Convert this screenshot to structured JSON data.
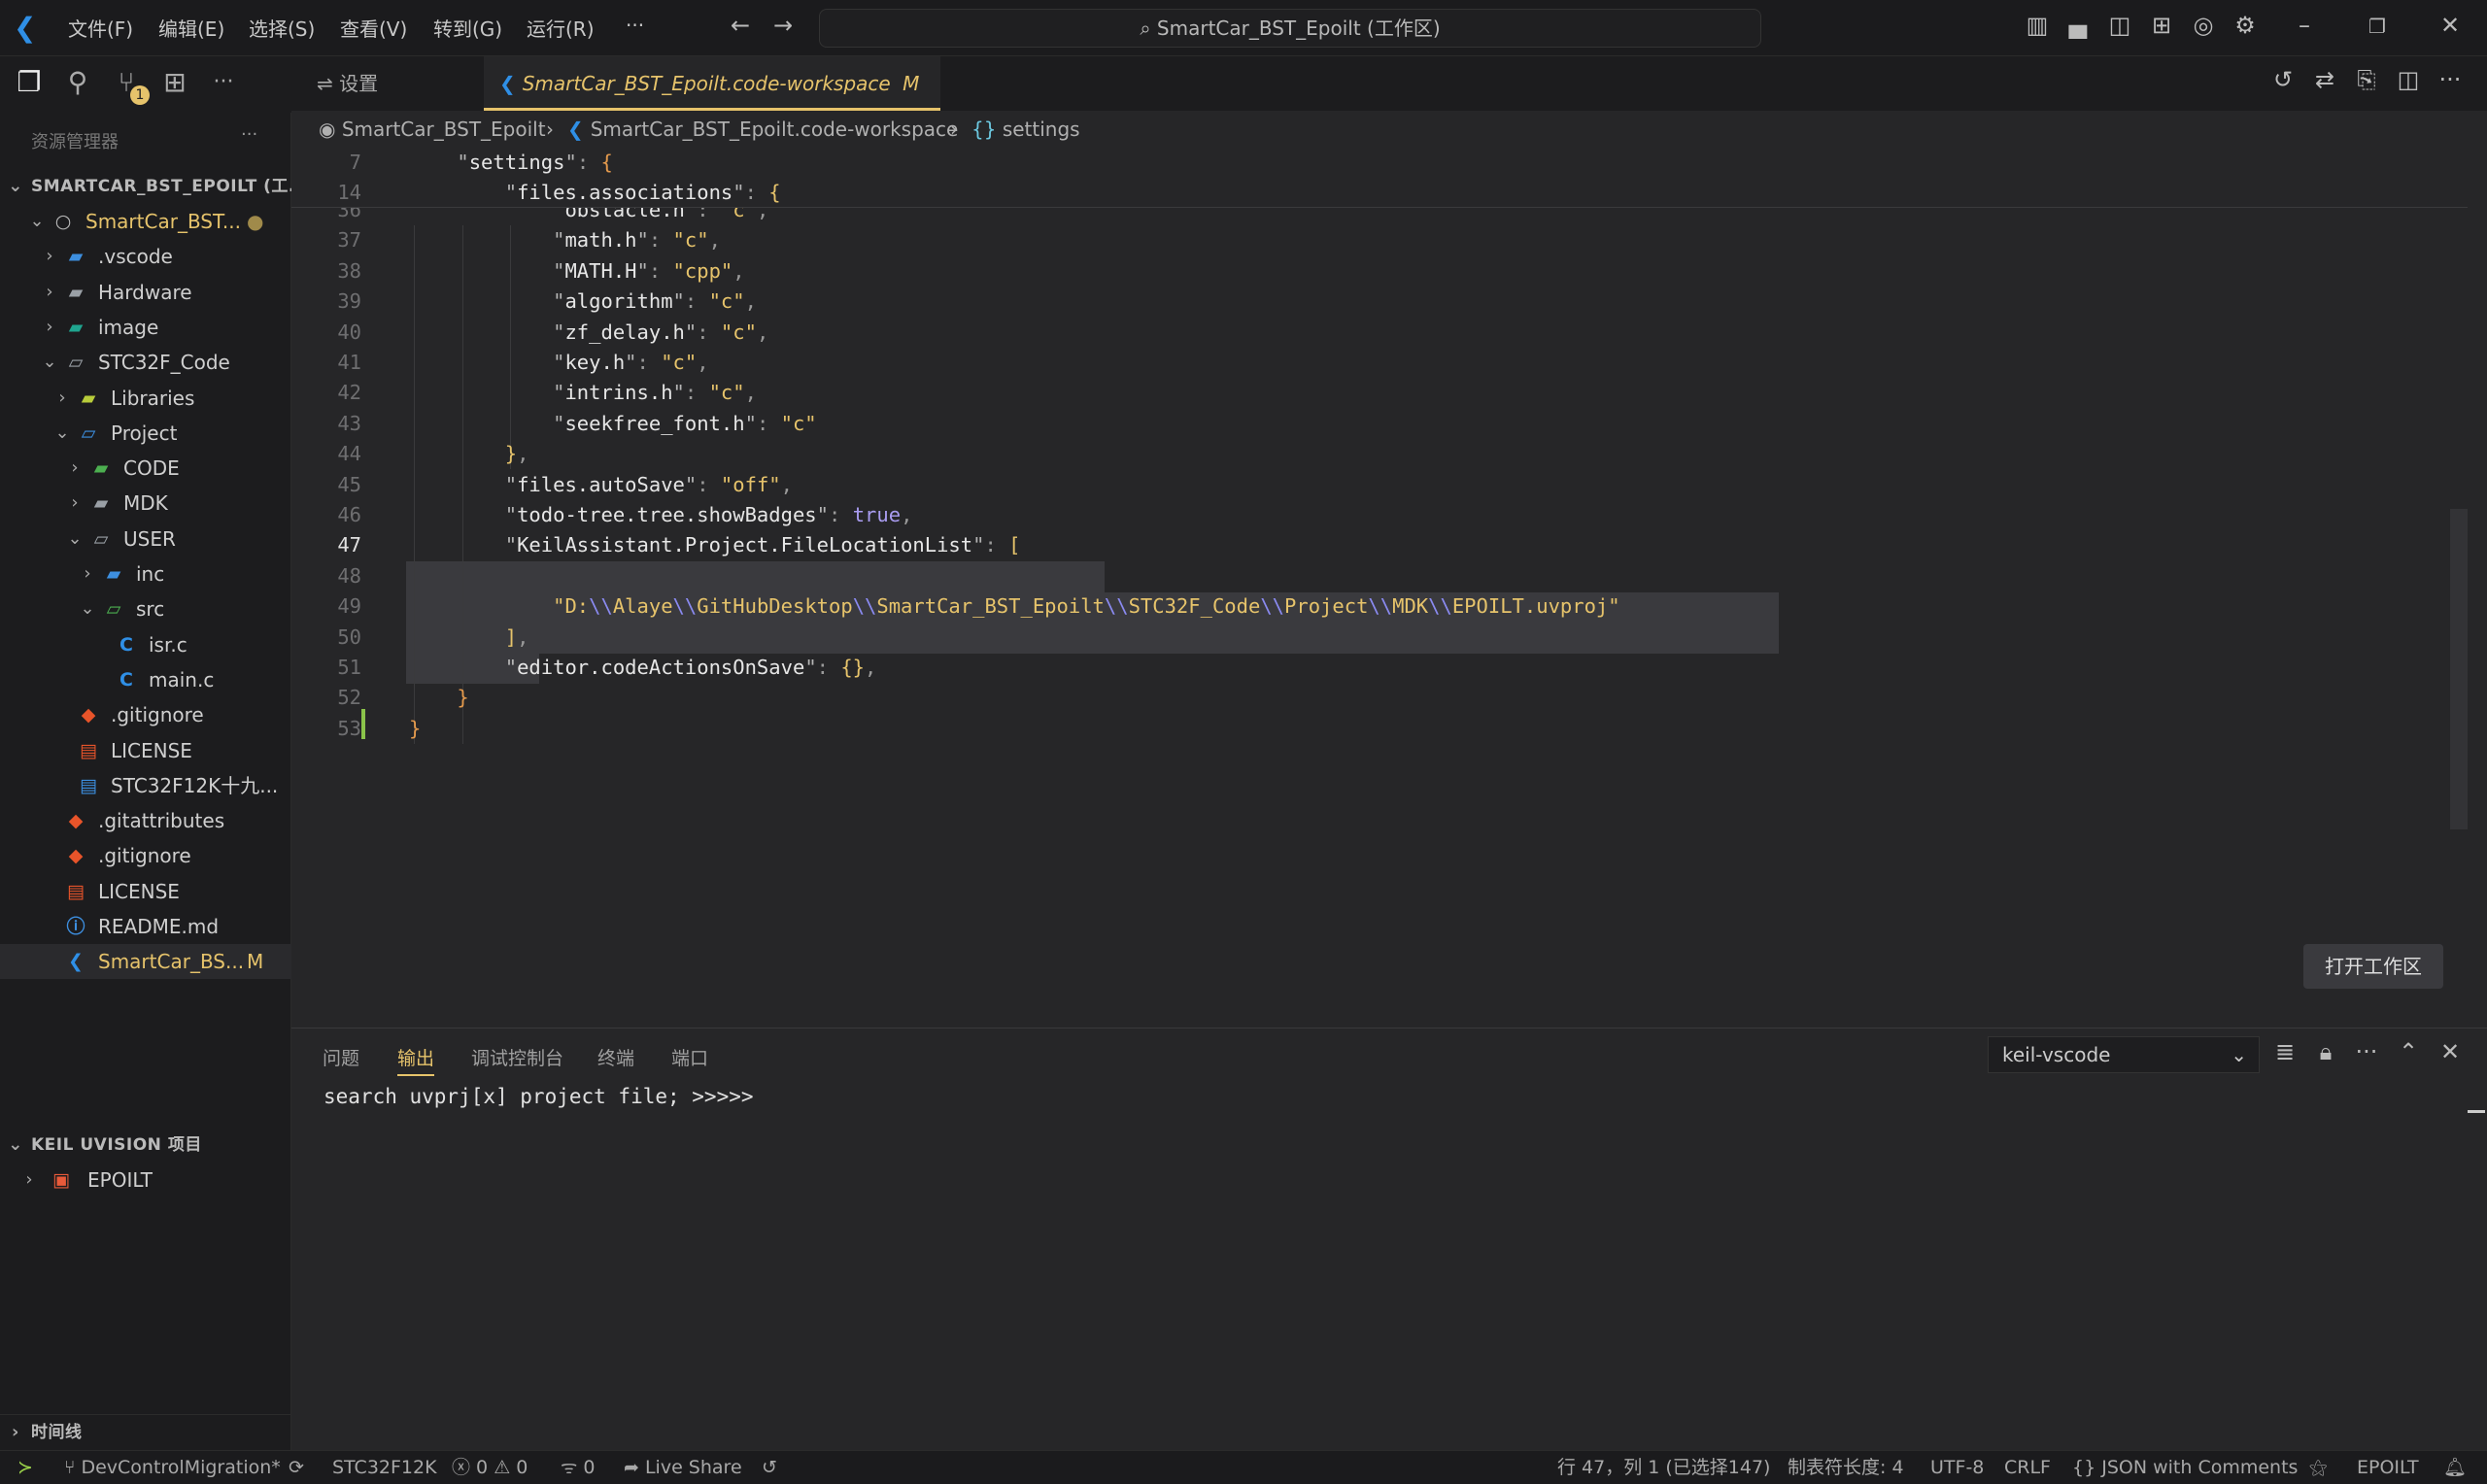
{
  "titlebar": {
    "menus": [
      "文件(F)",
      "编辑(E)",
      "选择(S)",
      "查看(V)",
      "转到(G)",
      "运行(R)",
      "···"
    ],
    "search": "SmartCar_BST_Epoilt (工作区)"
  },
  "activity": {
    "scm_badge": "1"
  },
  "sidebar": {
    "title": "资源管理器",
    "more": "···",
    "workspace_header": "SMARTCAR_BST_EPOILT (工...",
    "items": [
      {
        "label": "SmartCar_BST...",
        "depth": 0,
        "chev": "open",
        "icon": "root-folder-icon",
        "color": "#e6c36b",
        "badge": "●"
      },
      {
        "label": ".vscode",
        "depth": 1,
        "chev": "closed",
        "icon": "vscode-folder-icon"
      },
      {
        "label": "Hardware",
        "depth": 1,
        "chev": "closed",
        "icon": "folder-icon"
      },
      {
        "label": "image",
        "depth": 1,
        "chev": "closed",
        "icon": "image-folder-icon"
      },
      {
        "label": "STC32F_Code",
        "depth": 1,
        "chev": "open",
        "icon": "folder-open-icon"
      },
      {
        "label": "Libraries",
        "depth": 2,
        "chev": "closed",
        "icon": "library-folder-icon"
      },
      {
        "label": "Project",
        "depth": 2,
        "chev": "open",
        "icon": "project-folder-icon"
      },
      {
        "label": "CODE",
        "depth": 3,
        "chev": "closed",
        "icon": "code-folder-icon"
      },
      {
        "label": "MDK",
        "depth": 3,
        "chev": "closed",
        "icon": "folder-icon"
      },
      {
        "label": "USER",
        "depth": 3,
        "chev": "open",
        "icon": "folder-open-icon"
      },
      {
        "label": "inc",
        "depth": 4,
        "chev": "closed",
        "icon": "include-folder-icon"
      },
      {
        "label": "src",
        "depth": 4,
        "chev": "open",
        "icon": "src-folder-icon"
      },
      {
        "label": "isr.c",
        "depth": 5,
        "chev": "",
        "icon": "c-file-icon"
      },
      {
        "label": "main.c",
        "depth": 5,
        "chev": "",
        "icon": "c-file-icon"
      },
      {
        "label": ".gitignore",
        "depth": 2,
        "chev": "",
        "icon": "git-icon"
      },
      {
        "label": "LICENSE",
        "depth": 2,
        "chev": "",
        "icon": "license-icon"
      },
      {
        "label": "STC32F12K十九...",
        "depth": 2,
        "chev": "",
        "icon": "document-icon"
      },
      {
        "label": ".gitattributes",
        "depth": 1,
        "chev": "",
        "icon": "git-icon"
      },
      {
        "label": ".gitignore",
        "depth": 1,
        "chev": "",
        "icon": "git-icon"
      },
      {
        "label": "LICENSE",
        "depth": 1,
        "chev": "",
        "icon": "license-icon"
      },
      {
        "label": "README.md",
        "depth": 1,
        "chev": "",
        "icon": "info-icon"
      },
      {
        "label": "SmartCar_BS...",
        "depth": 1,
        "chev": "",
        "icon": "vscode-icon",
        "color": "#e6c36b",
        "badge": "M",
        "selected": true
      }
    ],
    "keil_header": "KEIL UVISION 项目",
    "keil_item": "EPOILT",
    "timeline": "时间线"
  },
  "tabs": [
    {
      "label": "设置",
      "active": false
    },
    {
      "label": "SmartCar_BST_Epoilt.code-workspace",
      "modified": "M",
      "close": "✕",
      "active": true
    }
  ],
  "breadcrumb": [
    "SmartCar_BST_Epoilt",
    "SmartCar_BST_Epoilt.code-workspace",
    "settings"
  ],
  "breadcrumb_settings_icon": "{}",
  "editor": {
    "sticky": [
      {
        "n": "7",
        "tokens": [
          [
            "    ",
            ""
          ],
          [
            "\"",
            "q"
          ],
          [
            "settings",
            "key"
          ],
          [
            "\"",
            "q"
          ],
          [
            ": ",
            "punc"
          ],
          [
            "{",
            "brace"
          ]
        ]
      },
      {
        "n": "14",
        "tokens": [
          [
            "        ",
            ""
          ],
          [
            "\"",
            "q"
          ],
          [
            "files.associations",
            "key"
          ],
          [
            "\"",
            "q"
          ],
          [
            ": ",
            "punc"
          ],
          [
            "{",
            "brack"
          ]
        ]
      }
    ],
    "lines": [
      {
        "n": "36",
        "tokens": [
          [
            "            ",
            ""
          ],
          [
            "\"",
            "q"
          ],
          [
            "obstacle.h",
            "key"
          ],
          [
            "\"",
            "q"
          ],
          [
            ": ",
            "punc"
          ],
          [
            "\"c\"",
            "str"
          ],
          [
            ",",
            "punc"
          ]
        ]
      },
      {
        "n": "37",
        "tokens": [
          [
            "            ",
            ""
          ],
          [
            "\"",
            "q"
          ],
          [
            "math.h",
            "key"
          ],
          [
            "\"",
            "q"
          ],
          [
            ": ",
            "punc"
          ],
          [
            "\"c\"",
            "str"
          ],
          [
            ",",
            "punc"
          ]
        ]
      },
      {
        "n": "38",
        "tokens": [
          [
            "            ",
            ""
          ],
          [
            "\"",
            "q"
          ],
          [
            "MATH.H",
            "key"
          ],
          [
            "\"",
            "q"
          ],
          [
            ": ",
            "punc"
          ],
          [
            "\"cpp\"",
            "str"
          ],
          [
            ",",
            "punc"
          ]
        ]
      },
      {
        "n": "39",
        "tokens": [
          [
            "            ",
            ""
          ],
          [
            "\"",
            "q"
          ],
          [
            "algorithm",
            "key"
          ],
          [
            "\"",
            "q"
          ],
          [
            ": ",
            "punc"
          ],
          [
            "\"c\"",
            "str"
          ],
          [
            ",",
            "punc"
          ]
        ]
      },
      {
        "n": "40",
        "tokens": [
          [
            "            ",
            ""
          ],
          [
            "\"",
            "q"
          ],
          [
            "zf_delay.h",
            "key"
          ],
          [
            "\"",
            "q"
          ],
          [
            ": ",
            "punc"
          ],
          [
            "\"c\"",
            "str"
          ],
          [
            ",",
            "punc"
          ]
        ]
      },
      {
        "n": "41",
        "tokens": [
          [
            "            ",
            ""
          ],
          [
            "\"",
            "q"
          ],
          [
            "key.h",
            "key"
          ],
          [
            "\"",
            "q"
          ],
          [
            ": ",
            "punc"
          ],
          [
            "\"c\"",
            "str"
          ],
          [
            ",",
            "punc"
          ]
        ]
      },
      {
        "n": "42",
        "tokens": [
          [
            "            ",
            ""
          ],
          [
            "\"",
            "q"
          ],
          [
            "intrins.h",
            "key"
          ],
          [
            "\"",
            "q"
          ],
          [
            ": ",
            "punc"
          ],
          [
            "\"c\"",
            "str"
          ],
          [
            ",",
            "punc"
          ]
        ]
      },
      {
        "n": "43",
        "tokens": [
          [
            "            ",
            ""
          ],
          [
            "\"",
            "q"
          ],
          [
            "seekfree_font.h",
            "key"
          ],
          [
            "\"",
            "q"
          ],
          [
            ": ",
            "punc"
          ],
          [
            "\"c\"",
            "str"
          ]
        ]
      },
      {
        "n": "44",
        "tokens": [
          [
            "        ",
            ""
          ],
          [
            "}",
            "brack"
          ],
          [
            ",",
            "punc"
          ]
        ]
      },
      {
        "n": "45",
        "tokens": [
          [
            "        ",
            ""
          ],
          [
            "\"",
            "q"
          ],
          [
            "files.autoSave",
            "key"
          ],
          [
            "\"",
            "q"
          ],
          [
            ": ",
            "punc"
          ],
          [
            "\"off\"",
            "str"
          ],
          [
            ",",
            "punc"
          ]
        ]
      },
      {
        "n": "46",
        "tokens": [
          [
            "        ",
            ""
          ],
          [
            "\"",
            "q"
          ],
          [
            "todo-tree.tree.showBadges",
            "key"
          ],
          [
            "\"",
            "q"
          ],
          [
            ": ",
            "punc"
          ],
          [
            "true",
            "bool"
          ],
          [
            ",",
            "punc"
          ]
        ]
      },
      {
        "n": "47",
        "tokens": [
          [
            "        ",
            ""
          ],
          [
            "\"",
            "q"
          ],
          [
            "KeilAssistant.Project.FileLocationList",
            "key"
          ],
          [
            "\"",
            "q"
          ],
          [
            ": ",
            "punc"
          ],
          [
            "[",
            "brack"
          ]
        ]
      },
      {
        "n": "48",
        "tokens": []
      },
      {
        "n": "49",
        "tokens": [
          [
            "            ",
            ""
          ],
          [
            "\"D:",
            "str"
          ],
          [
            "\\\\",
            "esc"
          ],
          [
            "Alaye",
            "str"
          ],
          [
            "\\\\",
            "esc"
          ],
          [
            "GitHubDesktop",
            "str"
          ],
          [
            "\\\\",
            "esc"
          ],
          [
            "SmartCar_BST_Epoilt",
            "str"
          ],
          [
            "\\\\",
            "esc"
          ],
          [
            "STC32F_Code",
            "str"
          ],
          [
            "\\\\",
            "esc"
          ],
          [
            "Project",
            "str"
          ],
          [
            "\\\\",
            "esc"
          ],
          [
            "MDK",
            "str"
          ],
          [
            "\\\\",
            "esc"
          ],
          [
            "EPOILT.uvproj\"",
            "str"
          ]
        ]
      },
      {
        "n": "50",
        "tokens": [
          [
            "        ",
            ""
          ],
          [
            "]",
            "brack"
          ],
          [
            ",",
            "punc"
          ]
        ]
      },
      {
        "n": "51",
        "tokens": [
          [
            "        ",
            ""
          ],
          [
            "\"",
            "q"
          ],
          [
            "editor.codeActionsOnSave",
            "key"
          ],
          [
            "\"",
            "q"
          ],
          [
            ": ",
            "punc"
          ],
          [
            "{}",
            "brack"
          ],
          [
            ",",
            "punc"
          ]
        ]
      },
      {
        "n": "52",
        "tokens": [
          [
            "    ",
            ""
          ],
          [
            "}",
            "brace"
          ]
        ]
      },
      {
        "n": "53",
        "tokens": [
          [
            "",
            ""
          ],
          [
            "}",
            "brace"
          ]
        ]
      }
    ],
    "current_line": "47",
    "open_workspace_button": "打开工作区"
  },
  "panel": {
    "tabs": [
      "问题",
      "输出",
      "调试控制台",
      "终端",
      "端口"
    ],
    "active_tab": "输出",
    "channel": "keil-vscode",
    "output": "search uvprj[x] project file; >>>>>"
  },
  "statusbar": {
    "branch": "DevControlMigration*",
    "target": "STC32F12K",
    "errors": "0",
    "warnings": "0",
    "ports": "0",
    "liveshare": "Live Share",
    "position": "行 47，列 1 (已选择147)",
    "tab_size": "制表符长度: 4",
    "encoding": "UTF-8",
    "eol": "CRLF",
    "language": "JSON with Comments",
    "project": "EPOILT"
  },
  "colors": {
    "accent": "#e6c36b",
    "vscode_blue": "#2f8fe6",
    "added_line": "#8bc34a"
  }
}
